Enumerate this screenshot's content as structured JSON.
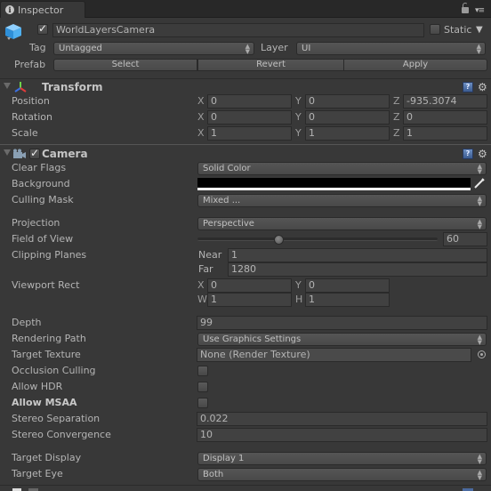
{
  "window": {
    "tab_label": "Inspector",
    "tab_icon": "info-icon"
  },
  "gameobject": {
    "active": true,
    "name": "WorldLayersCamera",
    "static_label": "Static",
    "static": false,
    "tag_label": "Tag",
    "tag_value": "Untagged",
    "layer_label": "Layer",
    "layer_value": "UI",
    "prefab_label": "Prefab",
    "prefab_buttons": [
      "Select",
      "Revert",
      "Apply"
    ]
  },
  "transform": {
    "title": "Transform",
    "rows": [
      {
        "label": "Position",
        "x": "0",
        "y": "0",
        "z": "-935.3074"
      },
      {
        "label": "Rotation",
        "x": "0",
        "y": "0",
        "z": "0"
      },
      {
        "label": "Scale",
        "x": "1",
        "y": "1",
        "z": "1"
      }
    ],
    "axis_labels": {
      "x": "X",
      "y": "Y",
      "z": "Z"
    }
  },
  "camera": {
    "title": "Camera",
    "enabled": true,
    "clear_flags": {
      "label": "Clear Flags",
      "value": "Solid Color"
    },
    "background": {
      "label": "Background",
      "color": "#000000"
    },
    "culling_mask": {
      "label": "Culling Mask",
      "value": "Mixed ..."
    },
    "projection": {
      "label": "Projection",
      "value": "Perspective"
    },
    "field_of_view": {
      "label": "Field of View",
      "value": "60",
      "min": 1,
      "max": 179,
      "current": 60
    },
    "clipping_planes": {
      "label": "Clipping Planes",
      "near_label": "Near",
      "near": "1",
      "far_label": "Far",
      "far": "1280"
    },
    "viewport_rect": {
      "label": "Viewport Rect",
      "x_label": "X",
      "x": "0",
      "y_label": "Y",
      "y": "0",
      "w_label": "W",
      "w": "1",
      "h_label": "H",
      "h": "1"
    },
    "depth": {
      "label": "Depth",
      "value": "99"
    },
    "rendering_path": {
      "label": "Rendering Path",
      "value": "Use Graphics Settings"
    },
    "target_texture": {
      "label": "Target Texture",
      "value": "None (Render Texture)"
    },
    "occlusion_culling": {
      "label": "Occlusion Culling",
      "checked": false
    },
    "allow_hdr": {
      "label": "Allow HDR",
      "checked": false
    },
    "allow_msaa": {
      "label": "Allow MSAA",
      "checked": false
    },
    "stereo_separation": {
      "label": "Stereo Separation",
      "value": "0.022"
    },
    "stereo_convergence": {
      "label": "Stereo Convergence",
      "value": "10"
    },
    "target_display": {
      "label": "Target Display",
      "value": "Display 1"
    },
    "target_eye": {
      "label": "Target Eye",
      "value": "Both"
    }
  },
  "icons": {
    "help": "?",
    "gear": "⚙",
    "arrows": "▴▾"
  }
}
